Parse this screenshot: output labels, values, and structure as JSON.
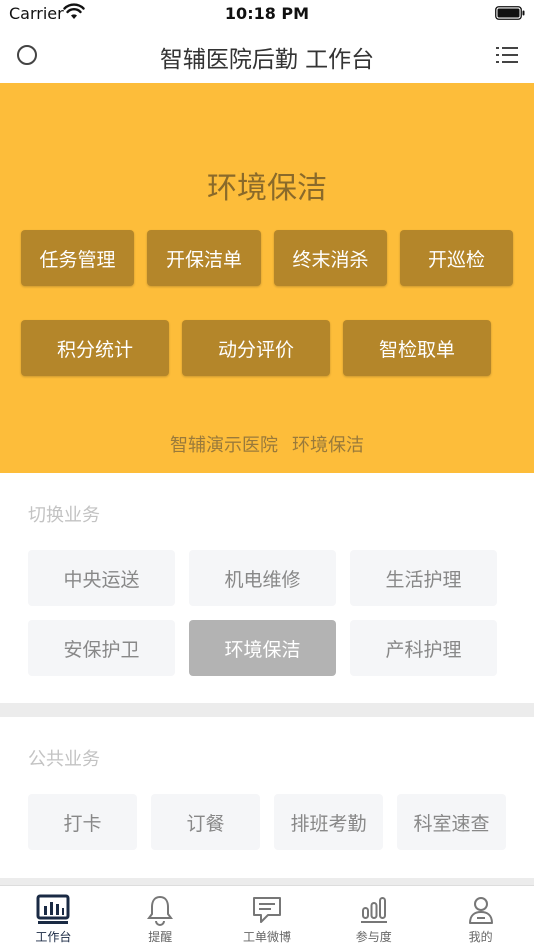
{
  "status_bar": {
    "carrier": "Carrier",
    "time": "10:18 PM"
  },
  "nav": {
    "title": "智辅医院后勤 工作台"
  },
  "hero": {
    "title": "环境保洁",
    "buttons": [
      "任务管理",
      "开保洁单",
      "终末消杀",
      "开巡检",
      "积分统计",
      "动分评价",
      "智检取单"
    ],
    "hospital": "智辅演示医院",
    "department": "环境保洁"
  },
  "switch_section": {
    "title": "切换业务",
    "items": [
      "中央运送",
      "机电维修",
      "生活护理",
      "安保护卫",
      "环境保洁",
      "产科护理"
    ],
    "active": "环境保洁"
  },
  "public_section": {
    "title": "公共业务",
    "items": [
      "打卡",
      "订餐",
      "排班考勤",
      "科室速查"
    ]
  },
  "tabs": [
    {
      "label": "工作台",
      "icon": "dashboard-icon",
      "active": true
    },
    {
      "label": "提醒",
      "icon": "bell-icon",
      "active": false
    },
    {
      "label": "工单微博",
      "icon": "chat-icon",
      "active": false
    },
    {
      "label": "参与度",
      "icon": "bar-chart-icon",
      "active": false
    },
    {
      "label": "我的",
      "icon": "user-icon",
      "active": false
    }
  ],
  "colors": {
    "hero_bg": "#fdbd3a",
    "hero_button": "#b4862a",
    "chip_bg": "#f5f6f8",
    "chip_active": "#b3b3b3",
    "tab_active": "#1a2a44"
  }
}
